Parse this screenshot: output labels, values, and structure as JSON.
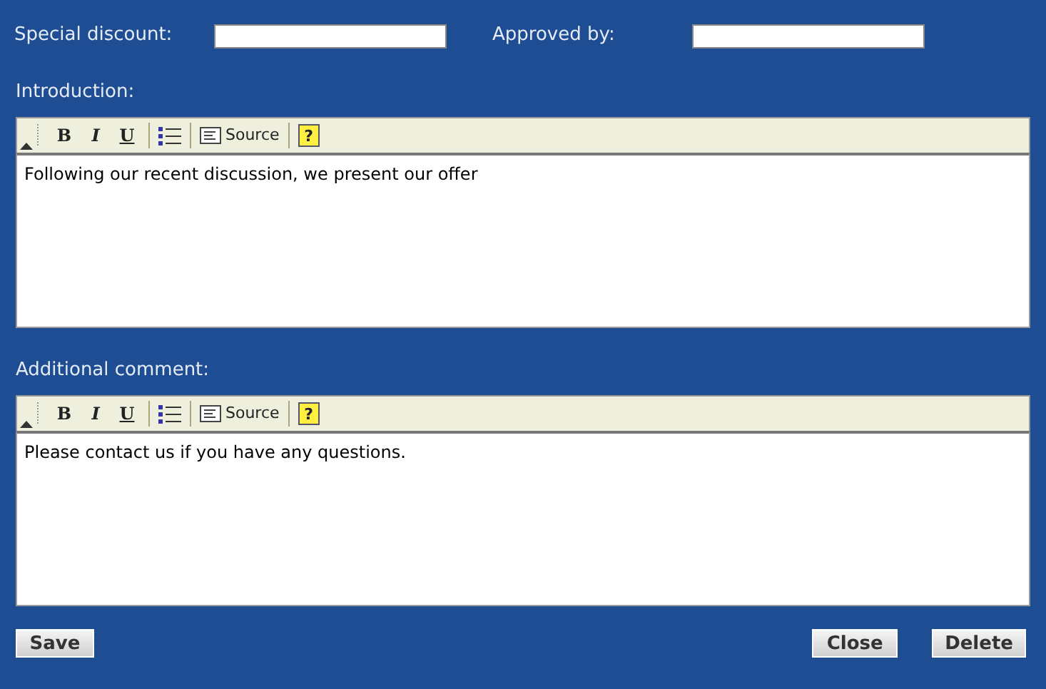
{
  "fields": [
    {
      "label": "Special discount:"
    },
    {
      "label": "Approved by:"
    }
  ],
  "editors": [
    {
      "label": "Introduction:",
      "toolbar": {
        "bold": "B",
        "italic": "I",
        "underline": "U",
        "source": "Source",
        "help": "?"
      },
      "content": "Following our recent discussion, we present our offer"
    },
    {
      "label": "Additional comment:",
      "toolbar": {
        "bold": "B",
        "italic": "I",
        "underline": "U",
        "source": "Source",
        "help": "?"
      },
      "content": "Please contact us if you have any questions."
    }
  ],
  "buttons": {
    "left": [
      "Save"
    ],
    "right": [
      "Close",
      "Delete"
    ]
  }
}
